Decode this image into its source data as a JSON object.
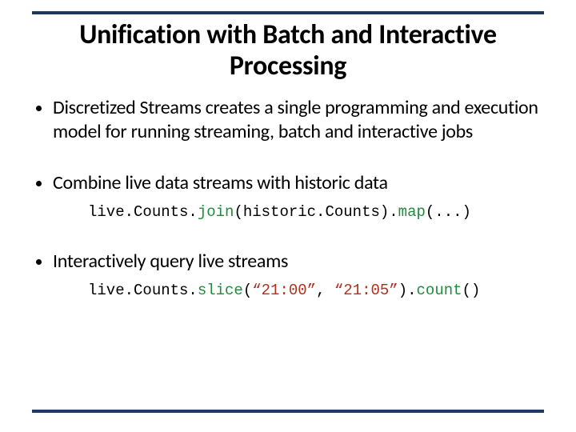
{
  "title": "Unification with Batch and Interactive Processing",
  "bullets": {
    "b1": "Discretized Streams creates a single programming and execution model for running streaming, batch and interactive jobs",
    "b2": "Combine live data streams with historic data",
    "b3": "Interactively query live streams"
  },
  "code1": {
    "p1": "live.Counts.",
    "fn1": "join",
    "p2": "(historic.Counts).",
    "fn2": "map",
    "p3": "(...)"
  },
  "code2": {
    "p1": "live.Counts.",
    "fn1": "slice",
    "p2": "(",
    "s1": "“21:00”",
    "p3": ", ",
    "s2": "“21:05”",
    "p4": ").",
    "fn2": "count",
    "p5": "()"
  }
}
